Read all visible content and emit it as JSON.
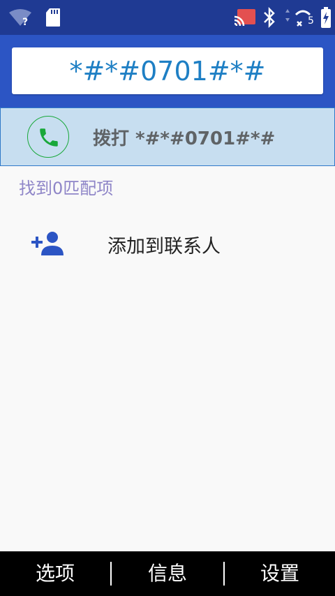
{
  "status_bar": {
    "wifi_icon": "wifi-unknown-icon",
    "sd_icon": "sd-card-icon",
    "cast_icon": "cast-icon",
    "bluetooth_icon": "bluetooth-icon",
    "signal_icon": "signal-no-service-icon",
    "battery_icon": "battery-charging-icon",
    "signal_badge": "5"
  },
  "dialer": {
    "input_value": "*#*#0701#*#"
  },
  "call_row": {
    "label": "拨打 *#*#0701#*#",
    "icon": "phone-icon"
  },
  "results": {
    "match_text": "找到0匹配项"
  },
  "add_contact": {
    "label": "添加到联系人",
    "icon": "add-person-icon"
  },
  "softkeys": {
    "left": "选项",
    "center": "信息",
    "right": "设置"
  },
  "colors": {
    "status_bar": "#1f3a93",
    "header": "#2c55c4",
    "accent_text": "#1e7fc4",
    "call_row_bg": "#c7def0",
    "call_icon_green": "#19a83a",
    "match_text": "#8f86c8"
  }
}
